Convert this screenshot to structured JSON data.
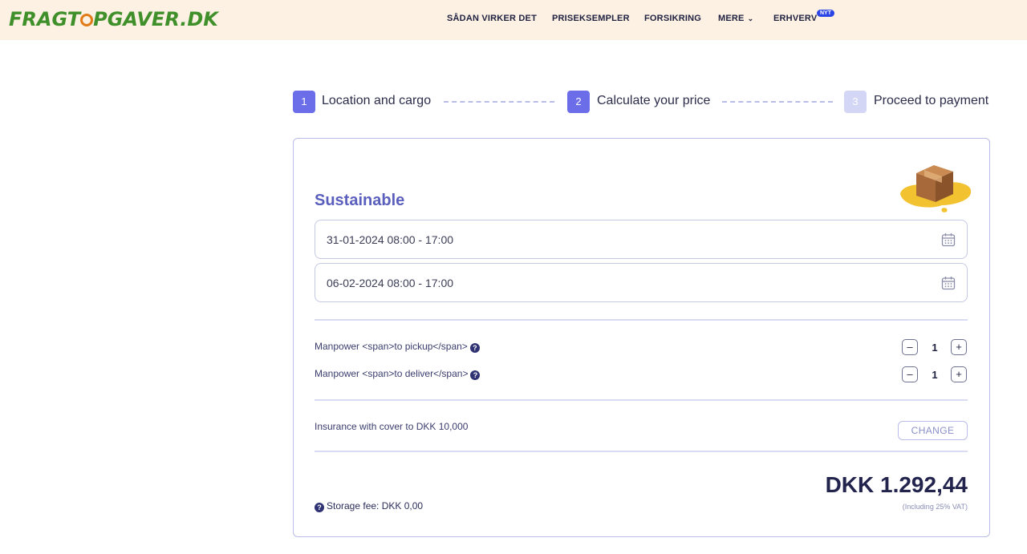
{
  "header": {
    "logo_left": "FRAGT",
    "logo_right": "PGAVER.DK",
    "nav": [
      {
        "label": "SÅDAN VIRKER DET"
      },
      {
        "label": "PRISEKSEMPLER"
      },
      {
        "label": "FORSIKRING"
      },
      {
        "label": "MERE"
      },
      {
        "label": "ERHVERV"
      }
    ],
    "badge": "NYT"
  },
  "steps": [
    {
      "number": "1",
      "label": "Location and cargo",
      "state": "active",
      "color": "#6b6ee8"
    },
    {
      "number": "2",
      "label": "Calculate your price",
      "state": "active",
      "color": "#6b6ee8"
    },
    {
      "number": "3",
      "label": "Proceed to payment",
      "state": "inactive",
      "color": "#d4d6f5"
    }
  ],
  "card": {
    "title": "Sustainable",
    "pickup_date": "31-01-2024 08:00 - 17:00",
    "delivery_date": "06-02-2024 08:00 - 17:00",
    "manpower_pickup_label": "Manpower <span>to pickup</span>",
    "manpower_deliver_label": "Manpower <span>to deliver</span>",
    "manpower_pickup_qty": "1",
    "manpower_deliver_qty": "1",
    "insurance_label": "Insurance with cover to DKK 10,000",
    "change_label": "CHANGE",
    "storage_fee": "Storage fee: DKK 0,00",
    "price": "DKK 1.292,44",
    "vat_note": "(Including 25% VAT)"
  },
  "colors": {
    "header_bg": "#fdf1e3",
    "logo_green": "#3f8f2a",
    "accent": "#6b6ee8",
    "title": "#5a5fbd"
  }
}
